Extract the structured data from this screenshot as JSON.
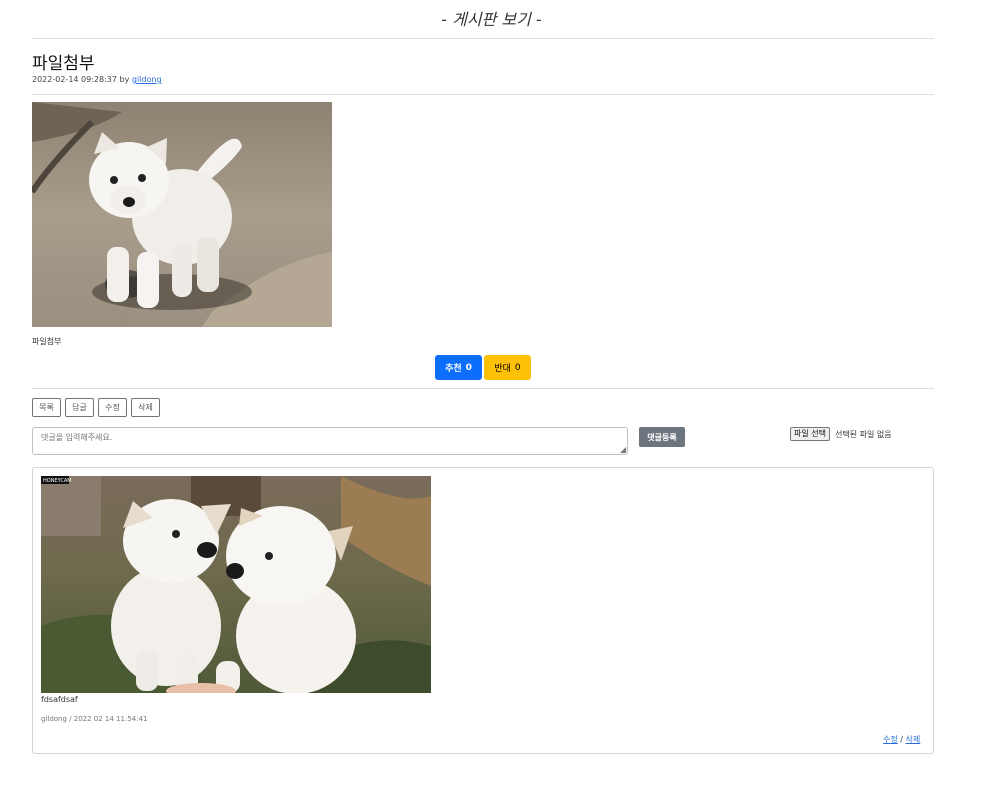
{
  "header": {
    "title": "- 게시판 보기 -"
  },
  "post": {
    "title": "파일첨부",
    "date": "2022-02-14 09:28:37",
    "by_label": "by",
    "author": "gildong",
    "attachment_caption": "파일첨부"
  },
  "votes": {
    "up_label": "추천",
    "up_count": "0",
    "down_label": "반대",
    "down_count": "0"
  },
  "actions": {
    "list": "목록",
    "reply": "답글",
    "edit": "수정",
    "delete": "삭제"
  },
  "comment_form": {
    "placeholder": "댓글을 입력해주세요.",
    "submit_label": "댓글등록",
    "file_button": "파일 선택",
    "file_status": "선택된 파일 없음"
  },
  "comment": {
    "text": "fdsafdsaf",
    "meta": "gildong / 2022 02 14 11:54:41",
    "edit": "수정",
    "separator": "/",
    "delete": "삭제",
    "watermark": "HONEYCAM"
  },
  "colors": {
    "primary": "#0d6efd",
    "warning": "#ffc107",
    "secondary": "#6c757d"
  }
}
